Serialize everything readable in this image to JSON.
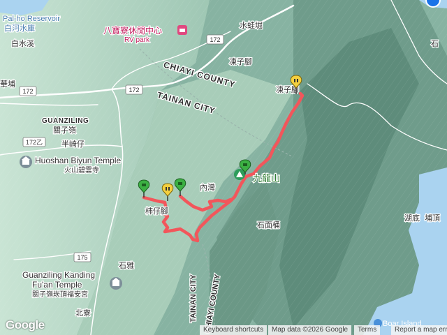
{
  "places": {
    "palho": "Pal-ho Reservoir",
    "baihe": "白河水庫",
    "baishuixi": "白水溪",
    "babao_cn": "八寶寮休閒中心",
    "babao_en": "RV park",
    "shuiwajue": "水蛙堀",
    "dongzijiao1": "凍子腳",
    "dongzijiao2": "凍子腳",
    "huapu": "華埔",
    "guanziling_en": "GUANZILING",
    "guanziling_cn": "關子嶺",
    "banqizi": "半崎仔",
    "huoshan_en": "Huoshan Biyun Temple",
    "huoshan_cn": "火山碧雲寺",
    "neiwan": "內灣",
    "jiulongshan": "九龍山",
    "shizijiao": "柿仔腳",
    "shimiantong": "石面桶",
    "huding": "湖底",
    "buding": "埔頂",
    "shi": "石",
    "shiya": "石雅",
    "kanding_en1": "Guanziling Kanding",
    "kanding_en2": "Fu'an Temple",
    "kanding_cn": "關子嶺崁頂福安宮",
    "beiliao": "北寮",
    "boar_island": "Boar Island"
  },
  "regions": {
    "chiayi_county": "CHIAYI COUNTY",
    "tainan_city": "TAINAN CITY"
  },
  "roads": {
    "r172a": "172",
    "r172b": "172",
    "r172c": "172",
    "r172yi": "172乙",
    "r175": "175"
  },
  "markers": [
    "start-marker-green",
    "waypoint-marker-yellow",
    "start-marker-green",
    "start-marker-green",
    "end-marker-yellow"
  ],
  "google_logo": "Google",
  "attribution": {
    "keyboard": "Keyboard shortcuts",
    "mapdata": "Map data ©2026 Google",
    "terms": "Terms",
    "report": "Report a map error"
  },
  "colors": {
    "track": "#f2565b",
    "terrain_light": "#b8dcc8",
    "terrain_dark": "#5f8f7f",
    "water": "#aad3f0",
    "road": "#ffffff"
  }
}
